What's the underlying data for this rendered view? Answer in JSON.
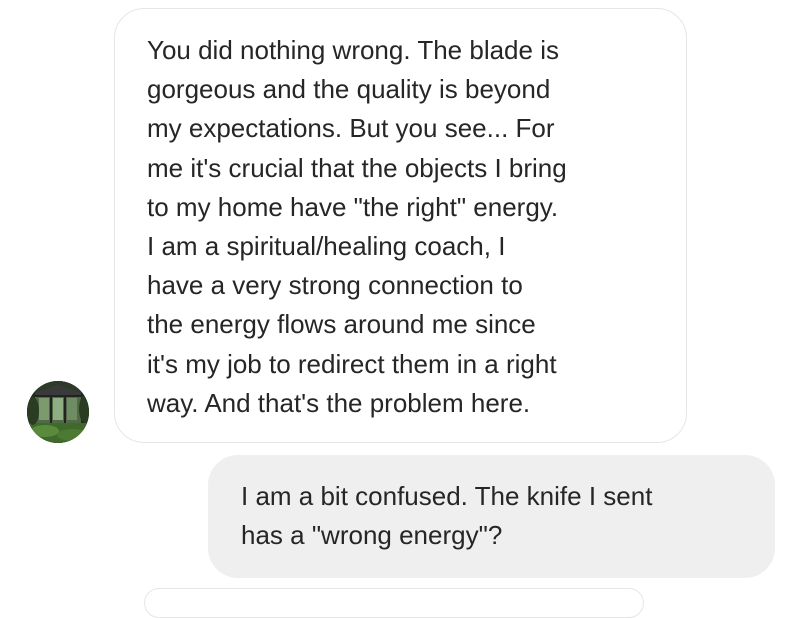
{
  "thread": {
    "messages": [
      {
        "sender": "contact",
        "text": "You did nothing wrong. The blade is\ngorgeous and the quality is beyond\nmy expectations. But you see... For\nme it's crucial that the objects I bring\nto my home have \"the right\" energy.\nI am a spiritual/healing coach, I\nhave  a very strong connection to\nthe energy flows around me since\nit's my job to redirect them in a right\nway. And that's the problem here."
      },
      {
        "sender": "me",
        "text": "I am a bit confused. The knife I sent\nhas a \"wrong energy\"?"
      }
    ]
  },
  "colors": {
    "incoming_bubble_bg": "#ffffff",
    "incoming_bubble_border": "#e6e6e6",
    "outgoing_bubble_bg": "#efefef",
    "text": "#262626"
  }
}
